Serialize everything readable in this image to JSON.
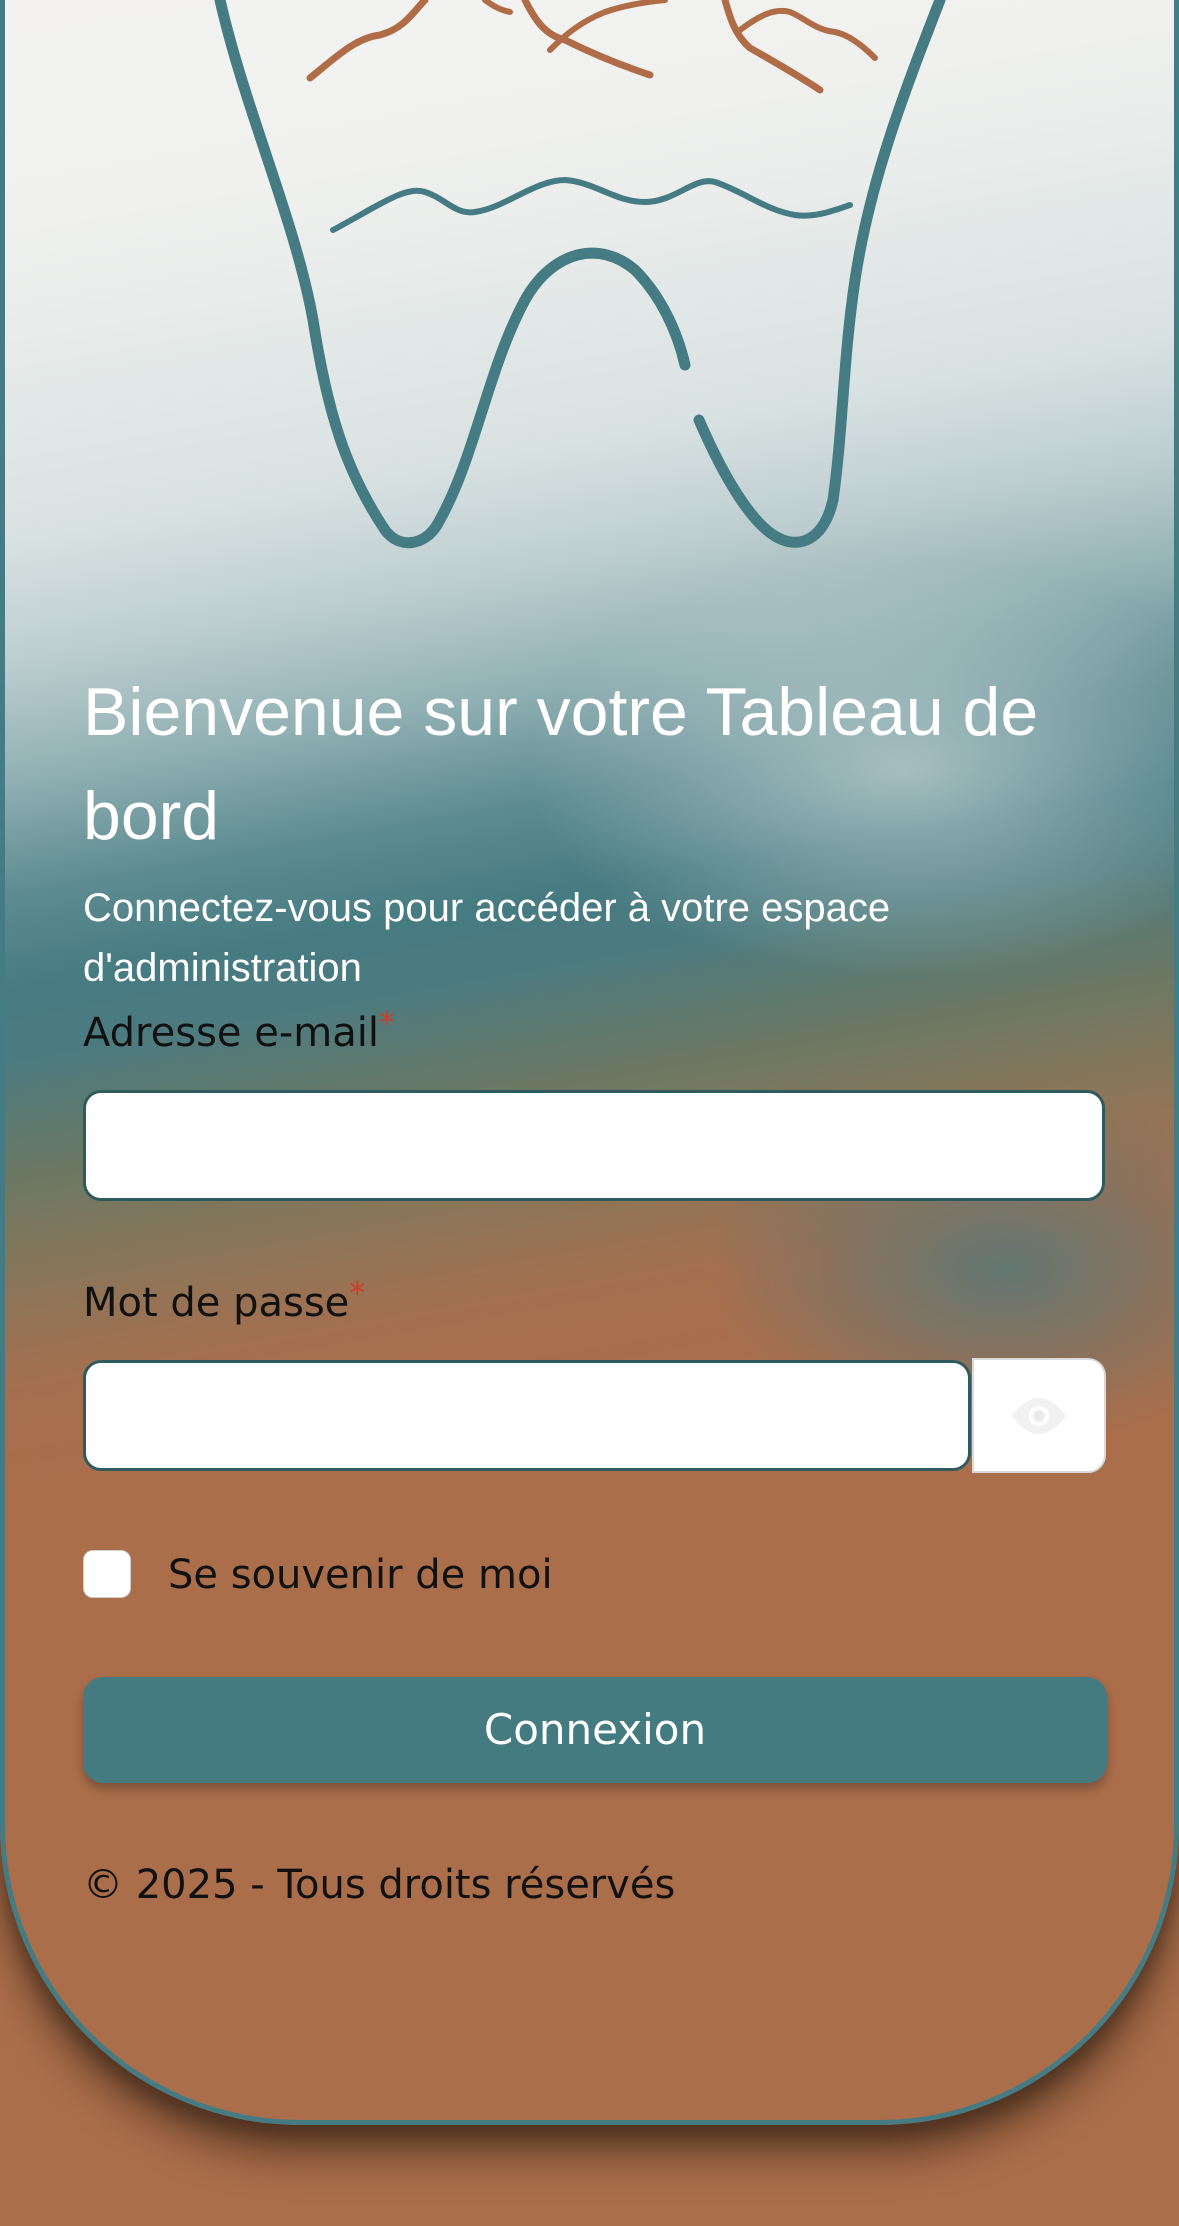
{
  "page": {
    "title": "Bienvenue sur votre Tableau de bord",
    "subtitle": "Connectez-vous pour accéder à votre espace d'administration"
  },
  "form": {
    "email_label": "Adresse e-mail",
    "email_value": "",
    "password_label": "Mot de passe",
    "password_value": "",
    "required_marker": "*",
    "remember_label": "Se souvenir de moi",
    "remember_checked": false,
    "submit_label": "Connexion"
  },
  "footer": {
    "copyright": "© 2025 - Tous droits réservés"
  },
  "icons": {
    "logo": "tooth-logo-icon",
    "password_toggle": "eye-icon"
  },
  "colors": {
    "teal": "#457b82",
    "copper": "#ab6e4a",
    "required": "#d33a2c"
  }
}
